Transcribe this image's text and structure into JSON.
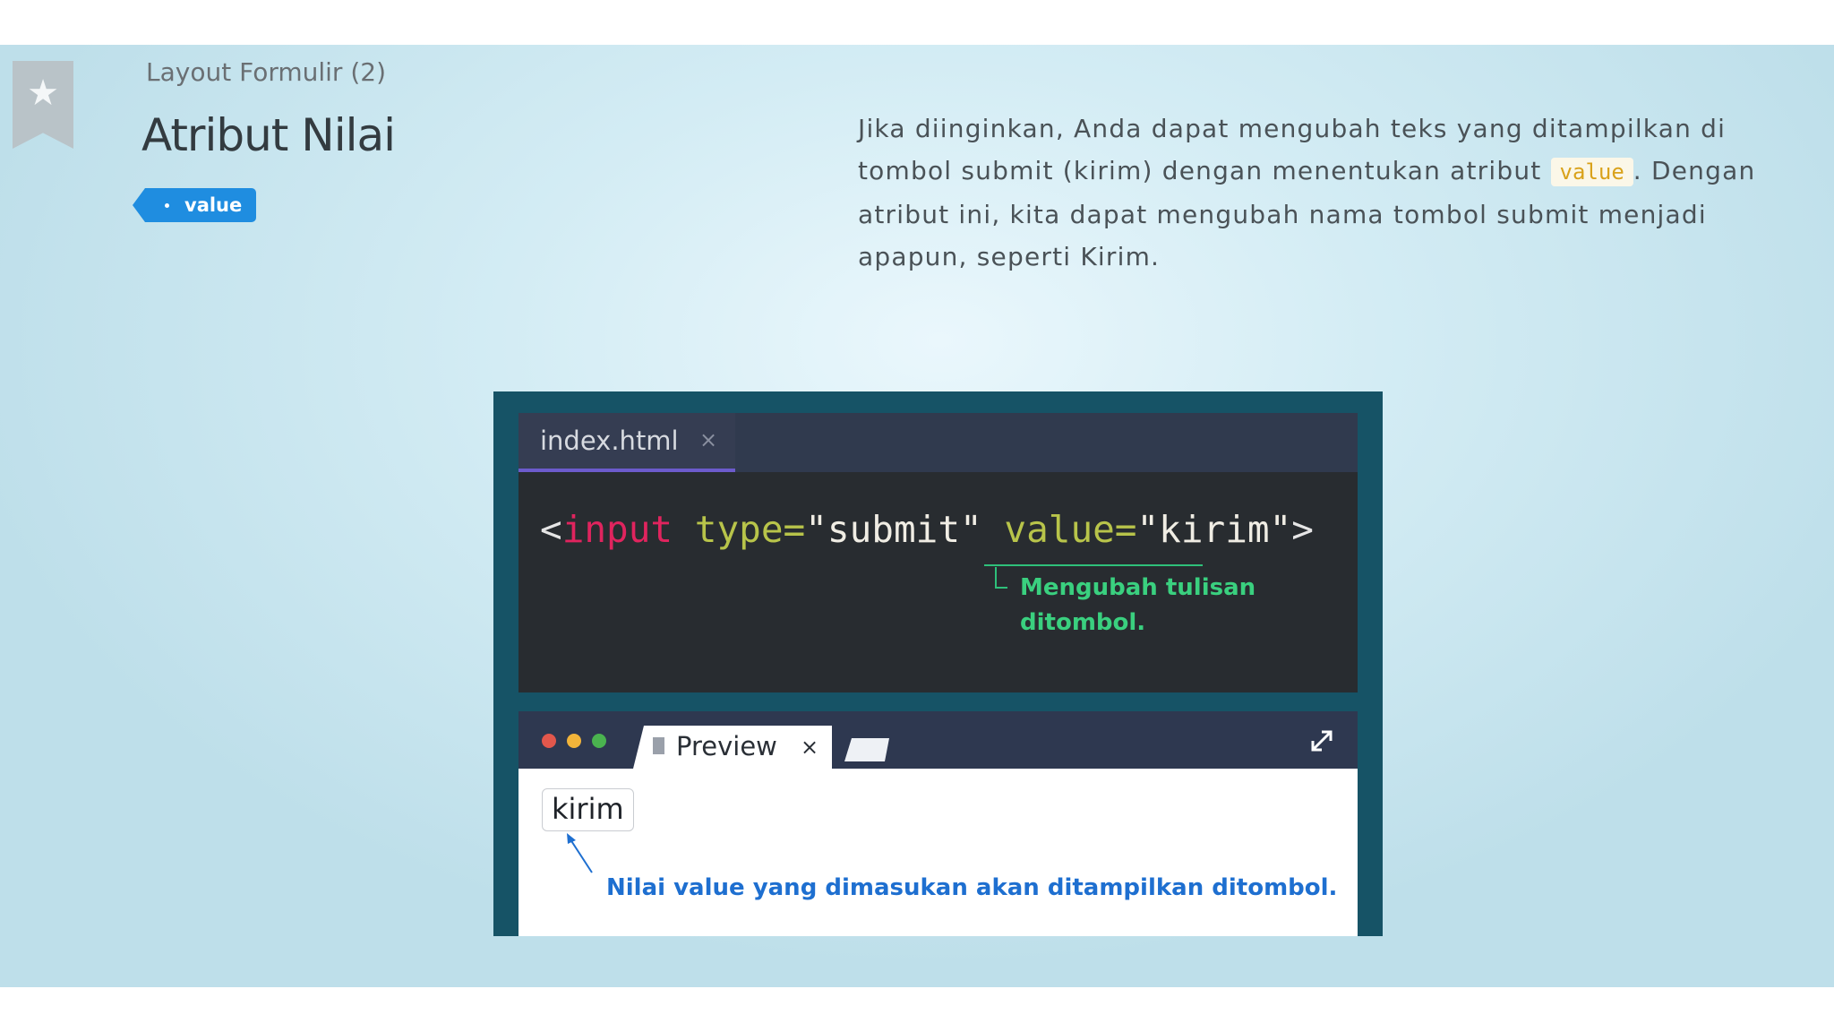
{
  "header": {
    "section": "Layout Formulir (2)",
    "title": "Atribut Nilai",
    "tag": "value"
  },
  "description": {
    "part1": "Jika diinginkan, Anda dapat mengubah teks yang ditampilkan di tombol submit (kirim) dengan menentukan atribut ",
    "code": "value",
    "part2": ". Dengan atribut ini, kita dapat mengubah nama tombol submit menjadi apapun, seperti Kirim."
  },
  "editor": {
    "filename": "index.html",
    "close_glyph": "×",
    "code": {
      "open": "<",
      "tag": "input",
      "attr1": "type=",
      "val1": "\"submit\"",
      "attr2": "value=",
      "val2": "\"kirim\"",
      "close": ">"
    },
    "note": "Mengubah tulisan ditombol."
  },
  "preview": {
    "tab_label": "Preview",
    "close_glyph": "×",
    "button_text": "kirim",
    "note": "Nilai value yang dimasukan akan ditampilkan ditombol."
  },
  "colors": {
    "traffic_red": "#e2574c",
    "traffic_yellow": "#f2b43a",
    "traffic_green": "#4ab34f"
  }
}
